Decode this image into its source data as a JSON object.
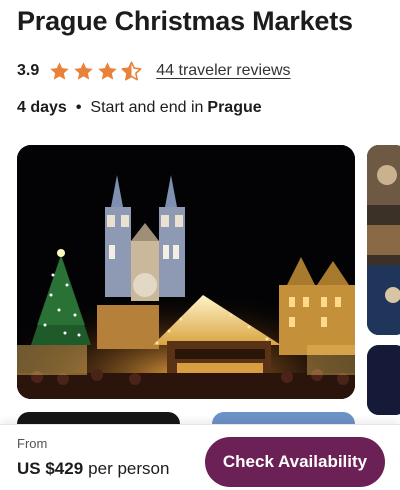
{
  "header": {
    "title": "Prague Christmas Markets"
  },
  "rating": {
    "value": "3.9",
    "stars_filled": 3.9,
    "stars_total": 5,
    "star_color": "#e8813a",
    "reviews_link": "44 traveler reviews"
  },
  "trip": {
    "days": "4 days",
    "separator": "•",
    "start_end_text": "Start and end in",
    "city": "Prague"
  },
  "gallery": {
    "main_photo": "prague-christmas-market-photo",
    "side_photos": [
      "christmas-market-photo",
      "night-photo"
    ]
  },
  "footer": {
    "from_label": "From",
    "price": "US $429",
    "per_person": "per person",
    "cta_label": "Check Availability",
    "cta_color": "#6b2156"
  }
}
